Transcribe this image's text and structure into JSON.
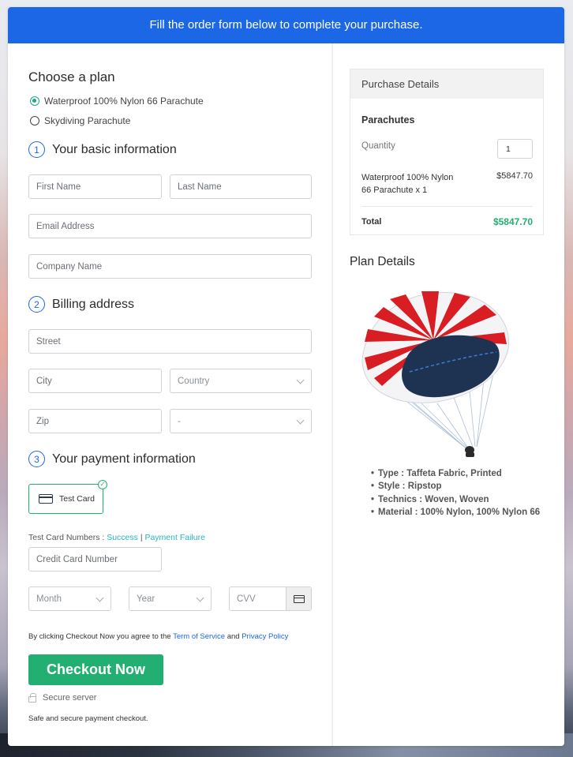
{
  "banner": {
    "text": "Fill the order form below to complete your purchase."
  },
  "plan": {
    "title": "Choose a plan",
    "options": [
      {
        "label": "Waterproof 100% Nylon 66 Parachute",
        "selected": true
      },
      {
        "label": "Skydiving Parachute",
        "selected": false
      }
    ]
  },
  "basic_info": {
    "step": "1",
    "title": "Your basic information",
    "first_name_placeholder": "First Name",
    "last_name_placeholder": "Last Name",
    "email_placeholder": "Email Address",
    "company_placeholder": "Company Name"
  },
  "billing": {
    "step": "2",
    "title": "Billing address",
    "street_placeholder": "Street",
    "city_placeholder": "City",
    "country_selected": "Country",
    "zip_placeholder": "Zip",
    "state_selected": "-"
  },
  "payment": {
    "step": "3",
    "title": "Your payment information",
    "method_label": "Test Card",
    "test_numbers_label": "Test Card Numbers :",
    "success_link": "Success",
    "separator": "|",
    "failure_link": "Payment Failure",
    "card_number_placeholder": "Credit Card Number",
    "month_selected": "Month",
    "year_selected": "Year",
    "cvv_placeholder": "CVV"
  },
  "agreement": {
    "prefix": "By clicking Checkout Now you agree to the",
    "terms_link": "Term of Service",
    "and": "and",
    "privacy_link": "Privacy Policy"
  },
  "checkout": {
    "button_label": "Checkout Now",
    "secure_label": "Secure server",
    "safe_text": "Safe and secure payment checkout."
  },
  "purchase_details": {
    "title": "Purchase Details",
    "product_group": "Parachutes",
    "quantity_label": "Quantity",
    "quantity_value": "1",
    "item_name": "Waterproof 100% Nylon 66 Parachute x 1",
    "item_price": "$5847.70",
    "total_label": "Total",
    "total_value": "$5847.70"
  },
  "plan_details": {
    "title": "Plan Details",
    "specs": [
      "Type : Taffeta Fabric, Printed",
      "Style : Ripstop",
      "Technics : Woven, Woven",
      "Material : 100% Nylon, 100% Nylon 66"
    ]
  },
  "colors": {
    "banner": "#1b67e6",
    "accent_green": "#22af71",
    "link_teal": "#28b4c4",
    "link_blue": "#1b67e6"
  }
}
